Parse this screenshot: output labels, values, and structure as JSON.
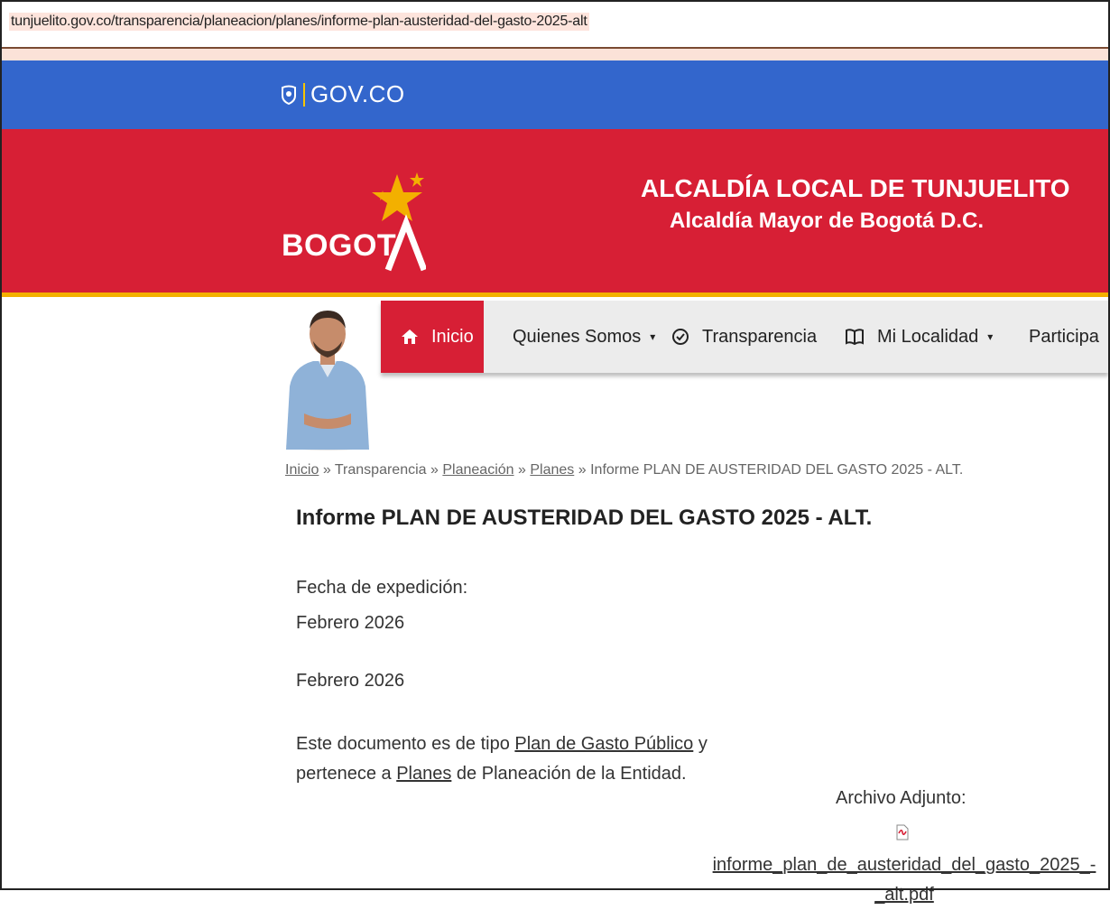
{
  "browser": {
    "url": "tunjuelito.gov.co/transparencia/planeacion/planes/informe-plan-austeridad-del-gasto-2025-alt"
  },
  "govbar": {
    "logo_text": "GOV.CO",
    "color": "#3366cc"
  },
  "header": {
    "bogota_logo": "BOGOT",
    "title": "ALCALDÍA LOCAL DE TUNJUELITO",
    "subtitle": "Alcaldía Mayor de Bogotá D.C.",
    "color": "#d71f35",
    "accent": "#f3b000"
  },
  "nav": {
    "items": [
      {
        "label": "Inicio",
        "icon": "home-icon",
        "active": true
      },
      {
        "label": "Quienes Somos",
        "dropdown": true
      },
      {
        "label": "Transparencia",
        "icon": "check-circle-icon"
      },
      {
        "label": "Mi Localidad",
        "icon": "book-icon",
        "dropdown": true
      },
      {
        "label": "Participa"
      }
    ],
    "caret": "▾"
  },
  "breadcrumb": {
    "items": [
      "Inicio",
      "Transparencia",
      "Planeación",
      "Planes",
      "Informe PLAN DE AUSTERIDAD DEL GASTO 2025 - ALT."
    ],
    "separator": "»"
  },
  "content": {
    "title": "Informe PLAN DE AUSTERIDAD DEL GASTO 2025 - ALT.",
    "fecha_label": "Fecha de expedición:",
    "fecha_value_1": "Febrero 2026",
    "fecha_value_2": "Febrero 2026",
    "desc_prefix": "Este documento es de tipo",
    "desc_type_link": "Plan de Gasto Público",
    "desc_mid": "y pertenece a",
    "desc_planes_link": "Planes",
    "desc_suffix": "de Planeación de la Entidad.",
    "attachment_label": "Archivo Adjunto:",
    "attachment_file": "informe_plan_de_austeridad_del_gasto_2025_-_alt.pdf"
  }
}
